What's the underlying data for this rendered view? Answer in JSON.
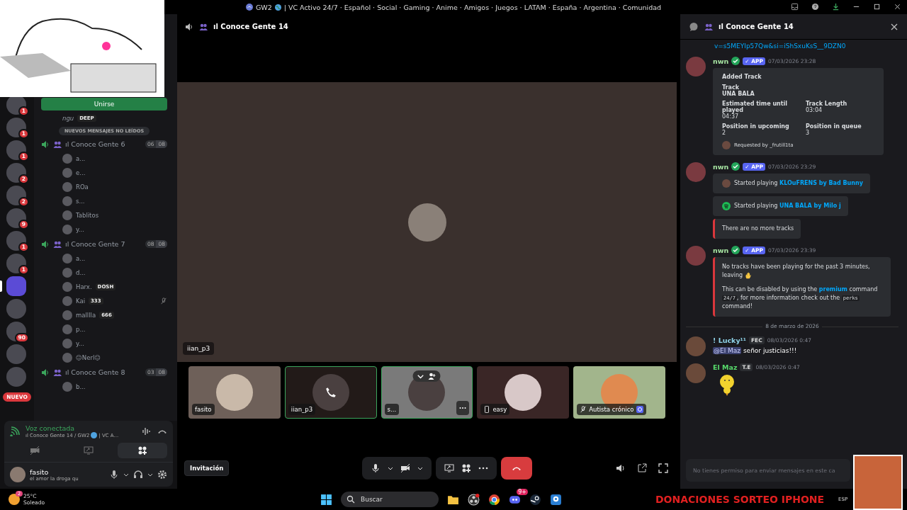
{
  "title_bar": {
    "parts": [
      {
        "text": "GW2"
      },
      {
        "kind": "globe"
      },
      {
        "text": "| VC Activo 24/7 · Español · Social · Gaming · Anime · Amigos · Juegos · LATAM · España · Argentina · Comunidad"
      }
    ]
  },
  "servers": [
    {
      "badge": "1",
      "selected": false
    },
    {
      "badge": "1",
      "selected": false
    },
    {
      "badge": "1",
      "selected": false
    },
    {
      "badge": "2",
      "selected": false
    },
    {
      "badge": "2",
      "selected": false
    },
    {
      "badge": "9",
      "selected": false
    },
    {
      "badge": "1",
      "selected": false
    },
    {
      "badge": "1",
      "selected": false
    },
    {
      "selected": true
    },
    {
      "selected": false
    },
    {
      "badge": "90",
      "selected": false
    },
    {
      "selected": false
    },
    {
      "selected": false
    }
  ],
  "new_server_label": "NUEVO",
  "join_button": "Unirse",
  "partial_user": {
    "name": "ngu",
    "tag": "DEEP"
  },
  "unread_pill": "NUEVOS MENSAJES NO LEÍDOS",
  "channels": [
    {
      "name": "ıl Conoce Gente 6",
      "count": "06",
      "limit": "08",
      "users": [
        {
          "name": "a...",
          "muted": false
        },
        {
          "name": "e...",
          "muted": false
        },
        {
          "name": "ROa",
          "muted": false
        },
        {
          "name": "s...",
          "muted": false
        },
        {
          "name": "Tablitos",
          "muted": false
        },
        {
          "name": "y...",
          "muted": false
        }
      ]
    },
    {
      "name": "ıl Conoce Gente 7",
      "count": "08",
      "limit": "08",
      "users": [
        {
          "name": "a...",
          "muted": false
        },
        {
          "name": "d...",
          "muted": false
        },
        {
          "name": "Harx.",
          "tag": "DOSH",
          "muted": false
        },
        {
          "name": "Kai",
          "tag": "333",
          "muted": true
        },
        {
          "name": "malllla",
          "tag": "666",
          "muted": false
        },
        {
          "name": "p...",
          "muted": false
        },
        {
          "name": "y...",
          "muted": false
        },
        {
          "name": "☺Nerl☺",
          "muted": false
        }
      ]
    },
    {
      "name": "ıl Conoce Gente 8",
      "count": "03",
      "limit": "08",
      "users": [
        {
          "name": "b...",
          "muted": false
        }
      ]
    }
  ],
  "voice_panel": {
    "status": "Voz conectada",
    "channel": [
      {
        "text": "ıl Conoce Gente 14 / GW2"
      },
      {
        "kind": "globe"
      },
      {
        "text": "| VC A..."
      }
    ]
  },
  "user_panel": {
    "name": "fasito",
    "status": "el amor la droga qu"
  },
  "call": {
    "title": "ıl Conoce Gente 14",
    "speaker": "iian_p3",
    "tiles": [
      {
        "name": "fasito",
        "selected": false,
        "kind": "plain"
      },
      {
        "name": "iian_p3",
        "selected": true,
        "kind": "call"
      },
      {
        "name": "s...",
        "selected": true,
        "kind": "menu"
      },
      {
        "name": "easy",
        "selected": false,
        "kind": "mobile"
      },
      {
        "name": "Autista crónico",
        "selected": false,
        "kind": "muted"
      }
    ],
    "invite_button": "Invitación"
  },
  "chat": {
    "title": "ıl Conoce Gente 14",
    "messages": [
      {
        "kind": "link_tail",
        "text": "v=s5MEYIp57Qw&si=iShSxuKsS__9DZN0"
      },
      {
        "kind": "bot",
        "author": "nwn",
        "color": "#a6e3a1",
        "badge": "✓ APP",
        "time": "07/03/2026 23:28",
        "embeds": [
          {
            "kind": "track",
            "title": "Added Track",
            "fields": [
              {
                "name": "Track",
                "value": "UNA BALA",
                "wide": true
              },
              {
                "name": "Estimated time until played",
                "value": "04:37",
                "wide": false
              },
              {
                "name": "Track Length",
                "value": "03:04",
                "wide": false
              },
              {
                "name": "Position in upcoming",
                "value": "2",
                "wide": false
              },
              {
                "name": "Position in queue",
                "value": "3",
                "wide": false
              }
            ],
            "footer": "Requested by _frutill1ta"
          }
        ]
      },
      {
        "kind": "bot",
        "author": "nwn",
        "color": "#a6e3a1",
        "badge": "✓ APP",
        "time": "07/03/2026 23:29",
        "embeds": [
          {
            "kind": "cover",
            "paragraphs": [
              [
                {
                  "text": "Started playing "
                },
                {
                  "kind": "link",
                  "text": "KLOuFRENS by Bad Bunny"
                }
              ]
            ]
          },
          {
            "kind": "service",
            "paragraphs": [
              [
                {
                  "text": "Started playing "
                },
                {
                  "kind": "link",
                  "text": "UNA BALA by Milo j"
                }
              ]
            ]
          },
          {
            "kind": "alert",
            "paragraphs": [
              [
                {
                  "text": "There are no more tracks"
                }
              ]
            ]
          }
        ]
      },
      {
        "kind": "bot",
        "author": "nwn",
        "color": "#a6e3a1",
        "badge": "✓ APP",
        "time": "07/03/2026 23:39",
        "embeds": [
          {
            "kind": "alert",
            "paragraphs": [
              [
                {
                  "text": "No tracks have been playing for the past 3 minutes, leaving "
                },
                {
                  "kind": "emoji"
                }
              ],
              [
                {
                  "text": "This can be disabled by using the "
                },
                {
                  "kind": "link",
                  "text": "premium"
                },
                {
                  "text": " command "
                },
                {
                  "kind": "code",
                  "text": "24/7"
                },
                {
                  "text": ", for more information check out the "
                },
                {
                  "kind": "code",
                  "text": "perks"
                },
                {
                  "text": " command!"
                }
              ]
            ]
          }
        ]
      },
      {
        "kind": "divider",
        "text": "8 de marzo de 2026"
      },
      {
        "kind": "user",
        "author": "! Lucky¹¹",
        "color": "#8fd3e8",
        "tag": "FEC",
        "time": "08/03/2026 0:47",
        "content": [
          {
            "kind": "mention",
            "text": "@El Maz"
          },
          {
            "text": " señor justicias!!!"
          }
        ],
        "sticker": false
      },
      {
        "kind": "user",
        "author": "El Maz",
        "color": "#57d96b",
        "tag": "T.E",
        "time": "08/03/2026 0:47",
        "sticker": true
      }
    ],
    "input_placeholder": "No tienes permiso para enviar mensajes en este ca"
  },
  "taskbar": {
    "temperature": "25°C",
    "weather": "Soleado",
    "weather_badge": "2",
    "search_placeholder": "Buscar",
    "discord_badge": "9+",
    "language": "ESP"
  },
  "stream_overlay": {
    "banner": "DONACIONES SORTEO IPHONE"
  }
}
